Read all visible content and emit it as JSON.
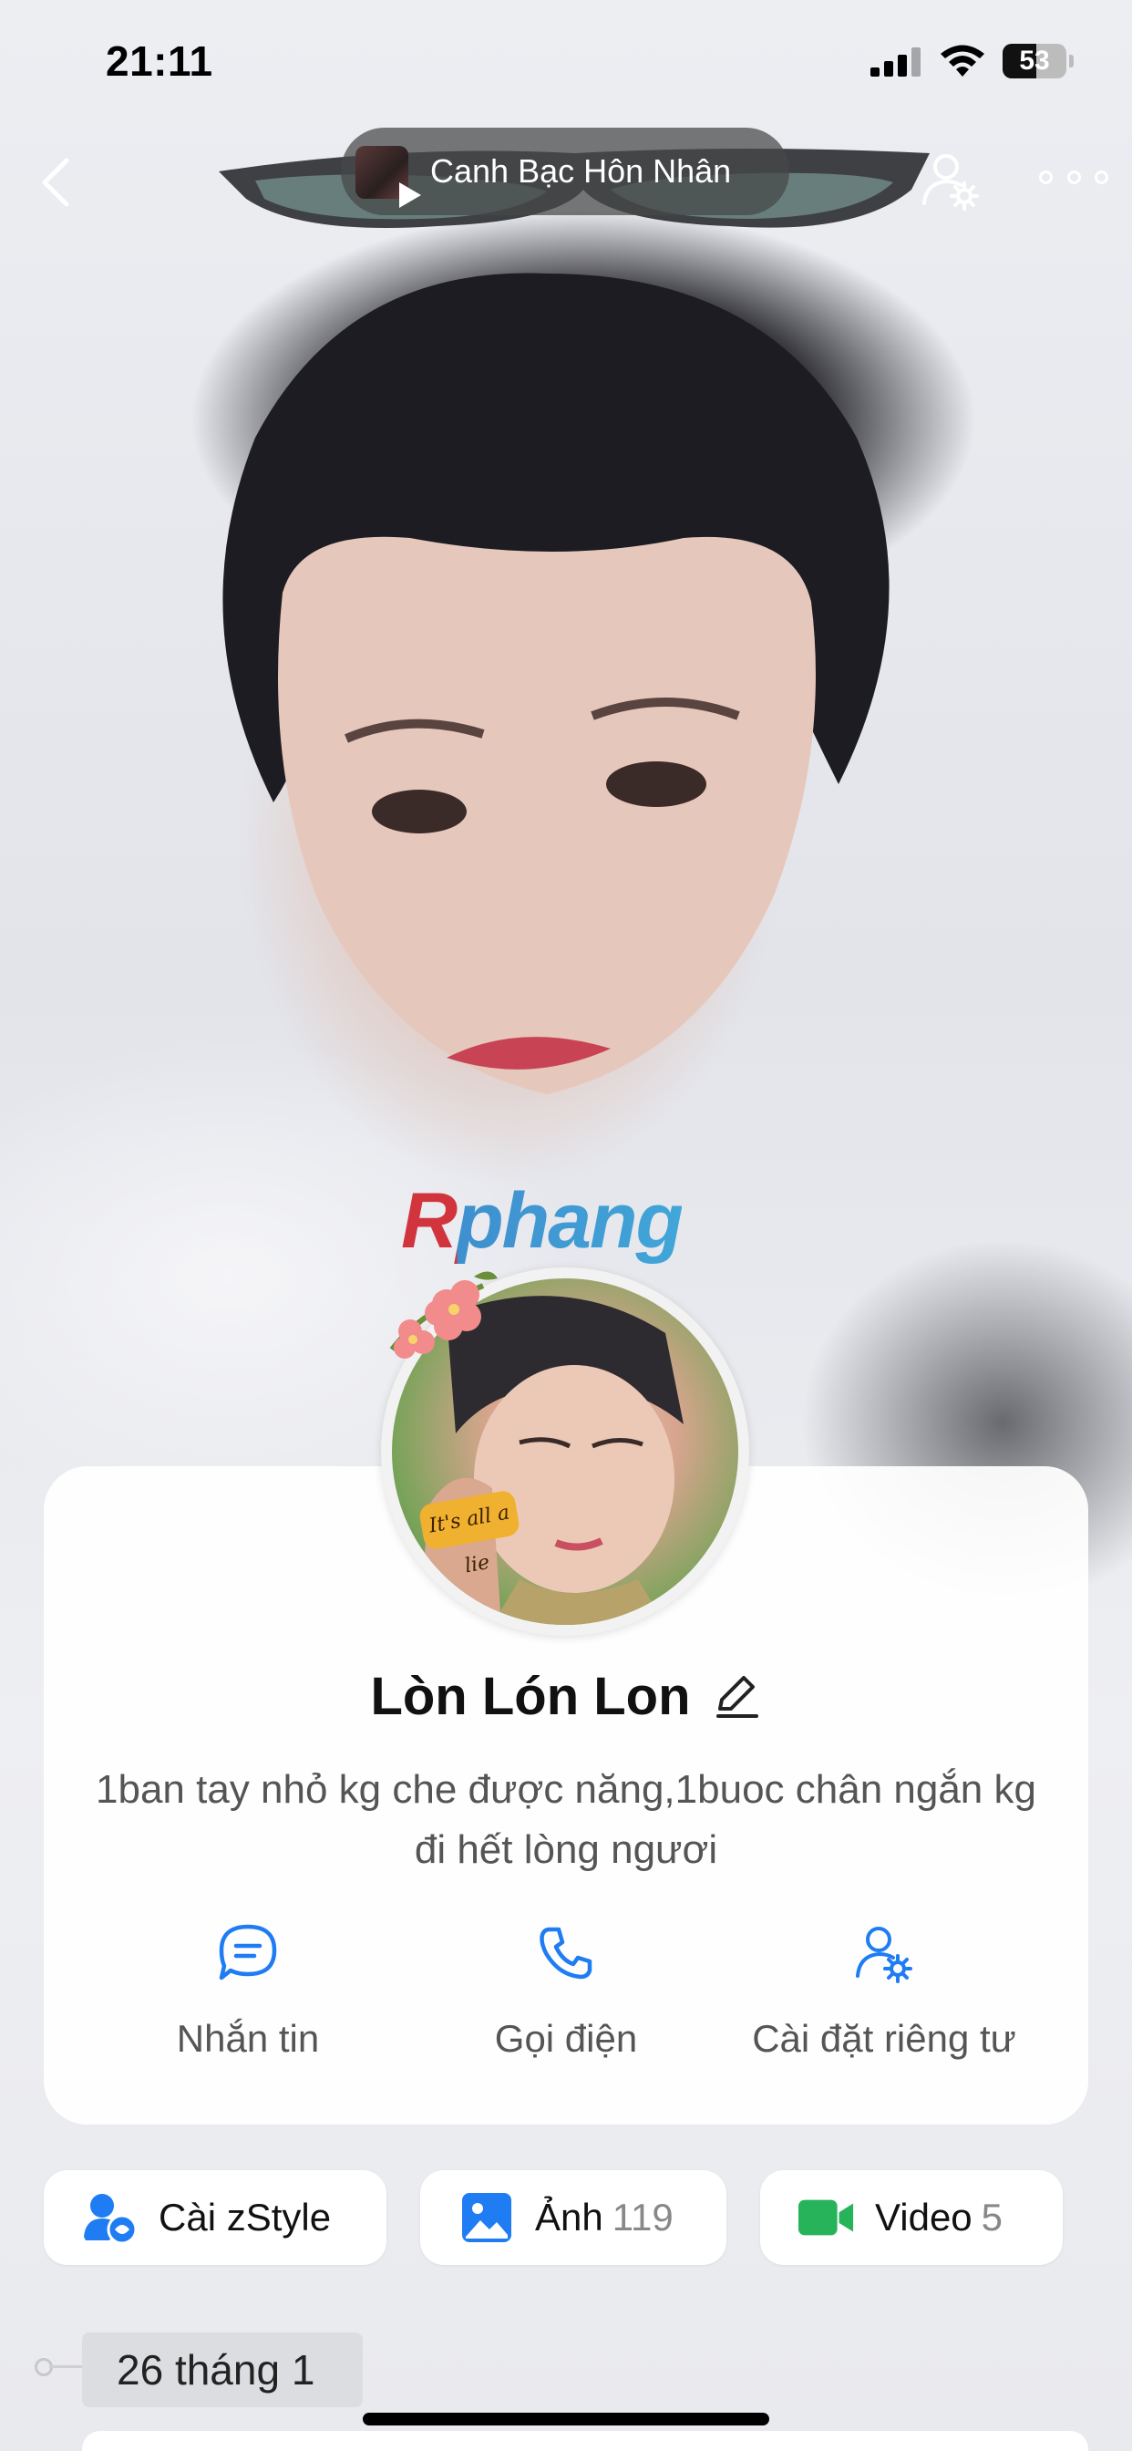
{
  "status_bar": {
    "time": "21:11",
    "battery_percent": 53,
    "battery_text": "53"
  },
  "header": {
    "music_title": "Canh Bạc Hôn Nhân"
  },
  "cover": {
    "watermark": "Rphang"
  },
  "avatar": {
    "sticker_text": "It's all a lie"
  },
  "profile": {
    "name": "Lòn Lón Lon",
    "bio": "1ban tay nhỏ kg che được năng,1buoc chân ngắn kg đi hết lòng ngươi"
  },
  "actions": [
    {
      "label": "Nhắn tin",
      "icon": "message-icon"
    },
    {
      "label": "Gọi điện",
      "icon": "phone-icon"
    },
    {
      "label": "Cài đặt riêng tư",
      "icon": "privacy-settings-icon"
    }
  ],
  "chips": [
    {
      "label": "Cài zStyle",
      "count": "",
      "icon": "zstyle-icon",
      "color": "#1f7cf2"
    },
    {
      "label": "Ảnh",
      "count": "119",
      "icon": "photo-icon",
      "color": "#1f7cf2"
    },
    {
      "label": "Video",
      "count": "5",
      "icon": "video-icon",
      "color": "#27b35a"
    }
  ],
  "timeline": {
    "date_label": "26 tháng 1"
  },
  "colors": {
    "accent": "#1f7cf2",
    "video_green": "#27b35a"
  }
}
